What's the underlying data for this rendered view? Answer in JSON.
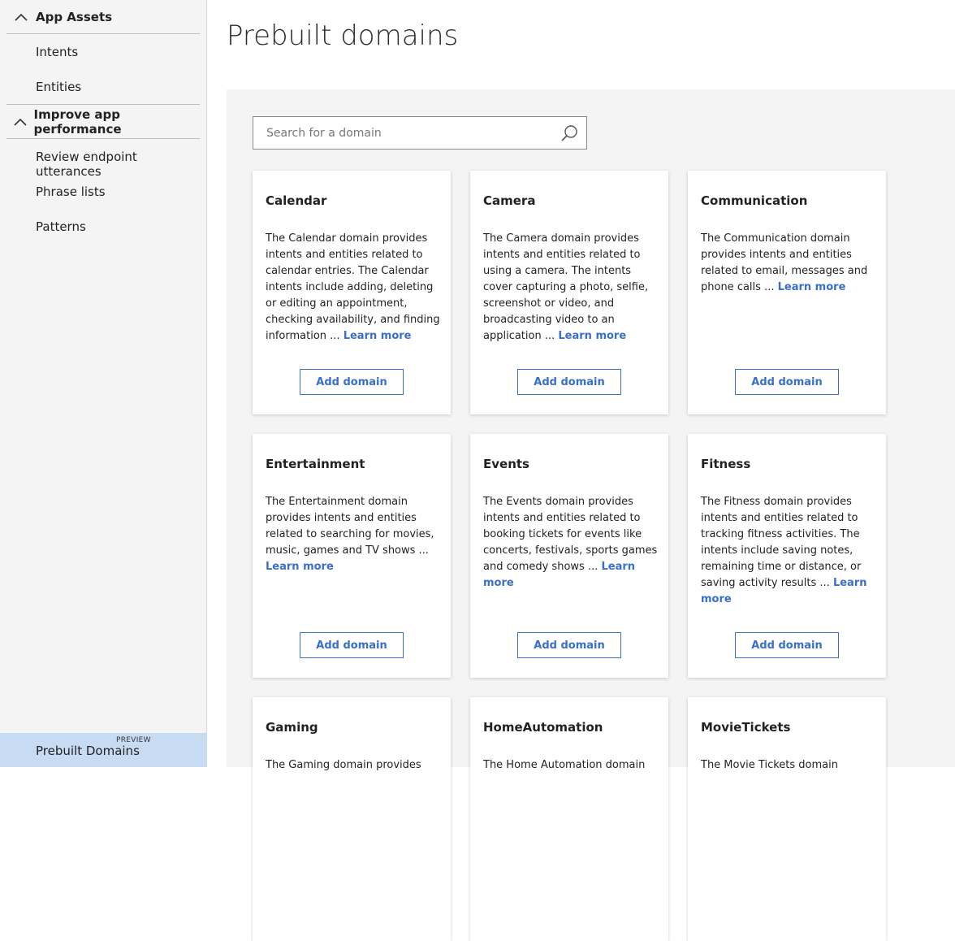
{
  "sidebar": {
    "app_assets": {
      "label": "App Assets"
    },
    "items_app_assets": [
      {
        "label": "Intents"
      },
      {
        "label": "Entities"
      }
    ],
    "improve": {
      "label": "Improve app performance"
    },
    "items_improve": [
      {
        "label": "Review endpoint utterances"
      },
      {
        "label": "Phrase lists"
      },
      {
        "label": "Patterns"
      }
    ],
    "active": {
      "label": "Prebuilt Domains",
      "badge": "PREVIEW"
    }
  },
  "page": {
    "title": "Prebuilt domains"
  },
  "search": {
    "placeholder": "Search for a domain"
  },
  "cards": [
    {
      "title": "Calendar",
      "desc": "The Calendar domain provides intents and entities related to calendar entries. The Calendar intents include adding, deleting or editing an appointment, checking availability, and finding information ...",
      "learn_more": "Learn more",
      "button": "Add domain"
    },
    {
      "title": "Camera",
      "desc": "The Camera domain provides intents and entities related to using a camera. The intents cover capturing a photo, selfie, screenshot or video, and broadcasting video to an application ...",
      "learn_more": "Learn more",
      "button": "Add domain"
    },
    {
      "title": "Communication",
      "desc": "The Communication domain provides intents and entities related to email, messages and phone calls ...",
      "learn_more": "Learn more",
      "button": "Add domain"
    },
    {
      "title": "Entertainment",
      "desc": "The Entertainment domain provides intents and entities related to searching for movies, music, games and TV shows ...",
      "learn_more": "Learn more",
      "button": "Add domain"
    },
    {
      "title": "Events",
      "desc": "The Events domain provides intents and entities related to booking tickets for events like concerts, festivals, sports games and comedy shows ...",
      "learn_more": "Learn more",
      "button": "Add domain"
    },
    {
      "title": "Fitness",
      "desc": "The Fitness domain provides intents and entities related to tracking fitness activities. The intents include saving notes, remaining time or distance, or saving activity results ...",
      "learn_more": "Learn more",
      "button": "Add domain"
    },
    {
      "title": "Gaming",
      "desc": "The Gaming domain provides",
      "learn_more": "",
      "button": ""
    },
    {
      "title": "HomeAutomation",
      "desc": "The Home Automation domain",
      "learn_more": "",
      "button": ""
    },
    {
      "title": "MovieTickets",
      "desc": "The Movie Tickets domain",
      "learn_more": "",
      "button": ""
    }
  ],
  "icons": {
    "search": "search-icon",
    "chevron": "chevron-up-icon"
  },
  "colors": {
    "accent": "#3a6fc9",
    "active_nav": "#c7dcf3",
    "panel": "#f4f4f4"
  }
}
